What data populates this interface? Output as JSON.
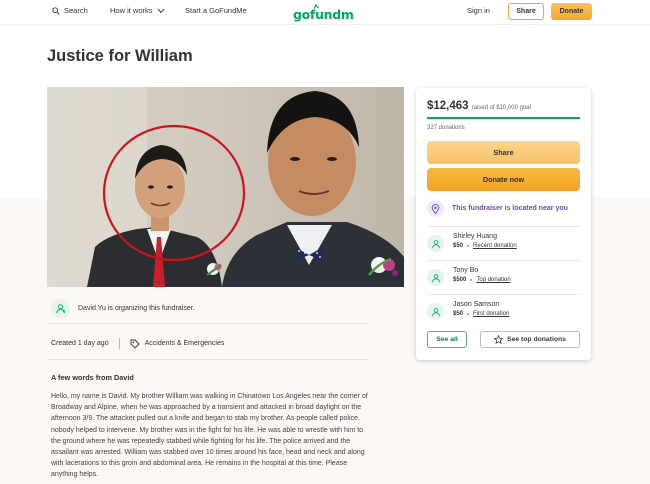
{
  "nav": {
    "search_label": "Search",
    "how_label": "How it works",
    "start_label": "Start a GoFundMe",
    "logo_text": "gofundme",
    "signin_label": "Sign in",
    "share_label": "Share",
    "donate_label": "Donate"
  },
  "campaign": {
    "title": "Justice for William",
    "organizer_text": "David Yu is organizing this fundraiser.",
    "created": "Created 1 day ago",
    "category": "Accidents & Emergencies",
    "story_title": "A few words from David",
    "story": "Hello, my name is David. My brother William was walking in Chinatown Los Angeles near the corner of Broadway and Alpine, when he was approached by a transient and attacked in broad daylight on the afternoon 3/9. The attacker pulled out a knife and began to stab my brother. As people called police, nobody helped to intervene. My brother was in the fight for his life. He was able to wrestle with him to the ground where he was repeatedly stabbed while fighting for his life. The police arrived and the assailant was arrested. William was stabbed over 10 times around his face, head and neck and along with lacerations to this groin and abdominal area. He remains in the hospital at this time. Please anything helps."
  },
  "sidebar": {
    "raised": "$12,463",
    "goal_text": "raised of $10,000 goal",
    "progress_fraction": 1.0,
    "donations_count": "327 donations",
    "share_label": "Share",
    "donate_label": "Donate now",
    "near_text": "This fundraiser is located near you",
    "donors": [
      {
        "name": "Shirley Huang",
        "amount": "$50",
        "tag": "Recent donation"
      },
      {
        "name": "Tony Bo",
        "amount": "$500",
        "tag": "Top donation"
      },
      {
        "name": "Jason Samson",
        "amount": "$50",
        "tag": "First donation"
      }
    ],
    "see_all_label": "See all",
    "see_top_label": "See top donations"
  },
  "colors": {
    "brand_green": "#02a95c",
    "donate_orange": "#f2a323",
    "near_purple": "#6b4ea8"
  }
}
